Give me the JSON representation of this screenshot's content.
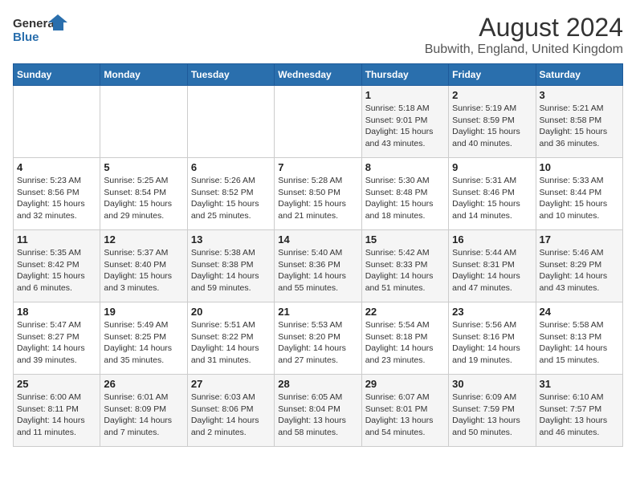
{
  "logo": {
    "line1": "General",
    "line2": "Blue"
  },
  "header": {
    "month": "August 2024",
    "location": "Bubwith, England, United Kingdom"
  },
  "weekdays": [
    "Sunday",
    "Monday",
    "Tuesday",
    "Wednesday",
    "Thursday",
    "Friday",
    "Saturday"
  ],
  "weeks": [
    [
      {
        "day": "",
        "sunrise": "",
        "sunset": "",
        "daylight": ""
      },
      {
        "day": "",
        "sunrise": "",
        "sunset": "",
        "daylight": ""
      },
      {
        "day": "",
        "sunrise": "",
        "sunset": "",
        "daylight": ""
      },
      {
        "day": "",
        "sunrise": "",
        "sunset": "",
        "daylight": ""
      },
      {
        "day": "1",
        "sunrise": "Sunrise: 5:18 AM",
        "sunset": "Sunset: 9:01 PM",
        "daylight": "Daylight: 15 hours and 43 minutes."
      },
      {
        "day": "2",
        "sunrise": "Sunrise: 5:19 AM",
        "sunset": "Sunset: 8:59 PM",
        "daylight": "Daylight: 15 hours and 40 minutes."
      },
      {
        "day": "3",
        "sunrise": "Sunrise: 5:21 AM",
        "sunset": "Sunset: 8:58 PM",
        "daylight": "Daylight: 15 hours and 36 minutes."
      }
    ],
    [
      {
        "day": "4",
        "sunrise": "Sunrise: 5:23 AM",
        "sunset": "Sunset: 8:56 PM",
        "daylight": "Daylight: 15 hours and 32 minutes."
      },
      {
        "day": "5",
        "sunrise": "Sunrise: 5:25 AM",
        "sunset": "Sunset: 8:54 PM",
        "daylight": "Daylight: 15 hours and 29 minutes."
      },
      {
        "day": "6",
        "sunrise": "Sunrise: 5:26 AM",
        "sunset": "Sunset: 8:52 PM",
        "daylight": "Daylight: 15 hours and 25 minutes."
      },
      {
        "day": "7",
        "sunrise": "Sunrise: 5:28 AM",
        "sunset": "Sunset: 8:50 PM",
        "daylight": "Daylight: 15 hours and 21 minutes."
      },
      {
        "day": "8",
        "sunrise": "Sunrise: 5:30 AM",
        "sunset": "Sunset: 8:48 PM",
        "daylight": "Daylight: 15 hours and 18 minutes."
      },
      {
        "day": "9",
        "sunrise": "Sunrise: 5:31 AM",
        "sunset": "Sunset: 8:46 PM",
        "daylight": "Daylight: 15 hours and 14 minutes."
      },
      {
        "day": "10",
        "sunrise": "Sunrise: 5:33 AM",
        "sunset": "Sunset: 8:44 PM",
        "daylight": "Daylight: 15 hours and 10 minutes."
      }
    ],
    [
      {
        "day": "11",
        "sunrise": "Sunrise: 5:35 AM",
        "sunset": "Sunset: 8:42 PM",
        "daylight": "Daylight: 15 hours and 6 minutes."
      },
      {
        "day": "12",
        "sunrise": "Sunrise: 5:37 AM",
        "sunset": "Sunset: 8:40 PM",
        "daylight": "Daylight: 15 hours and 3 minutes."
      },
      {
        "day": "13",
        "sunrise": "Sunrise: 5:38 AM",
        "sunset": "Sunset: 8:38 PM",
        "daylight": "Daylight: 14 hours and 59 minutes."
      },
      {
        "day": "14",
        "sunrise": "Sunrise: 5:40 AM",
        "sunset": "Sunset: 8:36 PM",
        "daylight": "Daylight: 14 hours and 55 minutes."
      },
      {
        "day": "15",
        "sunrise": "Sunrise: 5:42 AM",
        "sunset": "Sunset: 8:33 PM",
        "daylight": "Daylight: 14 hours and 51 minutes."
      },
      {
        "day": "16",
        "sunrise": "Sunrise: 5:44 AM",
        "sunset": "Sunset: 8:31 PM",
        "daylight": "Daylight: 14 hours and 47 minutes."
      },
      {
        "day": "17",
        "sunrise": "Sunrise: 5:46 AM",
        "sunset": "Sunset: 8:29 PM",
        "daylight": "Daylight: 14 hours and 43 minutes."
      }
    ],
    [
      {
        "day": "18",
        "sunrise": "Sunrise: 5:47 AM",
        "sunset": "Sunset: 8:27 PM",
        "daylight": "Daylight: 14 hours and 39 minutes."
      },
      {
        "day": "19",
        "sunrise": "Sunrise: 5:49 AM",
        "sunset": "Sunset: 8:25 PM",
        "daylight": "Daylight: 14 hours and 35 minutes."
      },
      {
        "day": "20",
        "sunrise": "Sunrise: 5:51 AM",
        "sunset": "Sunset: 8:22 PM",
        "daylight": "Daylight: 14 hours and 31 minutes."
      },
      {
        "day": "21",
        "sunrise": "Sunrise: 5:53 AM",
        "sunset": "Sunset: 8:20 PM",
        "daylight": "Daylight: 14 hours and 27 minutes."
      },
      {
        "day": "22",
        "sunrise": "Sunrise: 5:54 AM",
        "sunset": "Sunset: 8:18 PM",
        "daylight": "Daylight: 14 hours and 23 minutes."
      },
      {
        "day": "23",
        "sunrise": "Sunrise: 5:56 AM",
        "sunset": "Sunset: 8:16 PM",
        "daylight": "Daylight: 14 hours and 19 minutes."
      },
      {
        "day": "24",
        "sunrise": "Sunrise: 5:58 AM",
        "sunset": "Sunset: 8:13 PM",
        "daylight": "Daylight: 14 hours and 15 minutes."
      }
    ],
    [
      {
        "day": "25",
        "sunrise": "Sunrise: 6:00 AM",
        "sunset": "Sunset: 8:11 PM",
        "daylight": "Daylight: 14 hours and 11 minutes."
      },
      {
        "day": "26",
        "sunrise": "Sunrise: 6:01 AM",
        "sunset": "Sunset: 8:09 PM",
        "daylight": "Daylight: 14 hours and 7 minutes."
      },
      {
        "day": "27",
        "sunrise": "Sunrise: 6:03 AM",
        "sunset": "Sunset: 8:06 PM",
        "daylight": "Daylight: 14 hours and 2 minutes."
      },
      {
        "day": "28",
        "sunrise": "Sunrise: 6:05 AM",
        "sunset": "Sunset: 8:04 PM",
        "daylight": "Daylight: 13 hours and 58 minutes."
      },
      {
        "day": "29",
        "sunrise": "Sunrise: 6:07 AM",
        "sunset": "Sunset: 8:01 PM",
        "daylight": "Daylight: 13 hours and 54 minutes."
      },
      {
        "day": "30",
        "sunrise": "Sunrise: 6:09 AM",
        "sunset": "Sunset: 7:59 PM",
        "daylight": "Daylight: 13 hours and 50 minutes."
      },
      {
        "day": "31",
        "sunrise": "Sunrise: 6:10 AM",
        "sunset": "Sunset: 7:57 PM",
        "daylight": "Daylight: 13 hours and 46 minutes."
      }
    ]
  ]
}
